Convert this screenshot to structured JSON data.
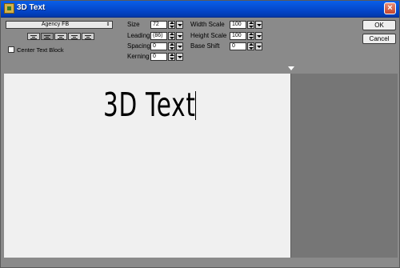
{
  "window": {
    "title": "3D Text",
    "close_glyph": "×"
  },
  "font": {
    "selected": "Agency FB",
    "arrow_glyph": "⇕"
  },
  "alignment": {
    "icon_names": [
      "align-left-icon",
      "align-center-icon",
      "align-right-icon",
      "align-justify-icon",
      "align-full-icon"
    ],
    "selected_index": 1
  },
  "center_text_block": {
    "label": "Center Text Block",
    "checked": false
  },
  "fields": {
    "size": {
      "label": "Size",
      "value": "72"
    },
    "leading": {
      "label": "Leading",
      "value": "(86)"
    },
    "spacing": {
      "label": "Spacing",
      "value": "0"
    },
    "kerning": {
      "label": "Kerning",
      "value": "0"
    },
    "width_scale": {
      "label": "Width Scale",
      "value": "100"
    },
    "height_scale": {
      "label": "Height Scale",
      "value": "100"
    },
    "base_shift": {
      "label": "Base Shift",
      "value": "0"
    }
  },
  "buttons": {
    "ok": "OK",
    "cancel": "Cancel"
  },
  "preview": {
    "text": "3D Text"
  },
  "colors": {
    "titlebar": "#0a5fe7",
    "panel": "#8a8a8a",
    "canvas": "#f0f0f0",
    "right_pane": "#767676"
  }
}
